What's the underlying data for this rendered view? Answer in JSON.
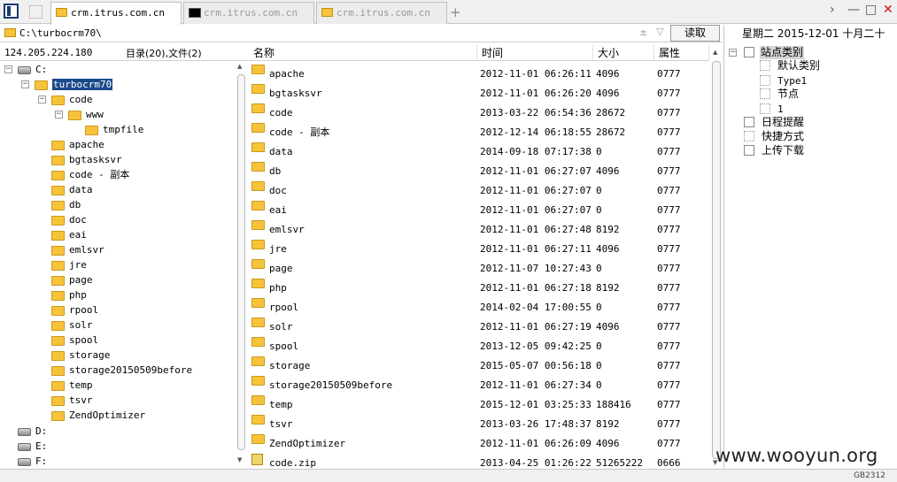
{
  "tabs": [
    {
      "label": "crm.itrus.com.cn",
      "icon": "folder-icon",
      "active": true
    },
    {
      "label": "crm.itrus.com.cn",
      "icon": "terminal-icon",
      "active": false
    },
    {
      "label": "crm.itrus.com.cn",
      "icon": "folder-icon",
      "active": false
    }
  ],
  "window": {
    "new_tab": "+",
    "nav": "›",
    "minimize": "—",
    "maximize": "□",
    "close": "✕",
    "close_color": "#d01010"
  },
  "address": {
    "path": "C:\\turbocrm70\\",
    "favorite_glyph": "±",
    "dropdown_glyph": "▽",
    "read_button": "读取"
  },
  "info": {
    "ip": "124.205.224.180",
    "counts": "目录(20),文件(2)"
  },
  "tree": {
    "drive_c": "C:",
    "root": "turbocrm70",
    "code": "code",
    "www": "www",
    "tmpfile": "tmpfile",
    "folders": [
      "apache",
      "bgtasksvr",
      "code - 副本",
      "data",
      "db",
      "doc",
      "eai",
      "emlsvr",
      "jre",
      "page",
      "php",
      "rpool",
      "solr",
      "spool",
      "storage",
      "storage20150509before",
      "temp",
      "tsvr",
      "ZendOptimizer"
    ],
    "drives": [
      "D:",
      "E:",
      "F:"
    ]
  },
  "list": {
    "headers": {
      "name": "名称",
      "time": "时间",
      "size": "大小",
      "attr": "属性"
    },
    "rows": [
      {
        "name": "apache",
        "time": "2012-11-01 06:26:11",
        "size": "4096",
        "attr": "0777",
        "type": "folder"
      },
      {
        "name": "bgtasksvr",
        "time": "2012-11-01 06:26:20",
        "size": "4096",
        "attr": "0777",
        "type": "folder"
      },
      {
        "name": "code",
        "time": "2013-03-22 06:54:36",
        "size": "28672",
        "attr": "0777",
        "type": "folder"
      },
      {
        "name": "code - 副本",
        "time": "2012-12-14 06:18:55",
        "size": "28672",
        "attr": "0777",
        "type": "folder"
      },
      {
        "name": "data",
        "time": "2014-09-18 07:17:38",
        "size": "0",
        "attr": "0777",
        "type": "folder"
      },
      {
        "name": "db",
        "time": "2012-11-01 06:27:07",
        "size": "4096",
        "attr": "0777",
        "type": "folder"
      },
      {
        "name": "doc",
        "time": "2012-11-01 06:27:07",
        "size": "0",
        "attr": "0777",
        "type": "folder"
      },
      {
        "name": "eai",
        "time": "2012-11-01 06:27:07",
        "size": "0",
        "attr": "0777",
        "type": "folder"
      },
      {
        "name": "emlsvr",
        "time": "2012-11-01 06:27:48",
        "size": "8192",
        "attr": "0777",
        "type": "folder"
      },
      {
        "name": "jre",
        "time": "2012-11-01 06:27:11",
        "size": "4096",
        "attr": "0777",
        "type": "folder"
      },
      {
        "name": "page",
        "time": "2012-11-07 10:27:43",
        "size": "0",
        "attr": "0777",
        "type": "folder"
      },
      {
        "name": "php",
        "time": "2012-11-01 06:27:18",
        "size": "8192",
        "attr": "0777",
        "type": "folder"
      },
      {
        "name": "rpool",
        "time": "2014-02-04 17:00:55",
        "size": "0",
        "attr": "0777",
        "type": "folder"
      },
      {
        "name": "solr",
        "time": "2012-11-01 06:27:19",
        "size": "4096",
        "attr": "0777",
        "type": "folder"
      },
      {
        "name": "spool",
        "time": "2013-12-05 09:42:25",
        "size": "0",
        "attr": "0777",
        "type": "folder"
      },
      {
        "name": "storage",
        "time": "2015-05-07 00:56:18",
        "size": "0",
        "attr": "0777",
        "type": "folder"
      },
      {
        "name": "storage20150509before",
        "time": "2012-11-01 06:27:34",
        "size": "0",
        "attr": "0777",
        "type": "folder"
      },
      {
        "name": "temp",
        "time": "2015-12-01 03:25:33",
        "size": "188416",
        "attr": "0777",
        "type": "folder"
      },
      {
        "name": "tsvr",
        "time": "2013-03-26 17:48:37",
        "size": "8192",
        "attr": "0777",
        "type": "folder"
      },
      {
        "name": "ZendOptimizer",
        "time": "2012-11-01 06:26:09",
        "size": "4096",
        "attr": "0777",
        "type": "folder"
      },
      {
        "name": "code.zip",
        "time": "2013-04-25 01:26:22",
        "size": "51265222",
        "attr": "0666",
        "type": "zip"
      }
    ]
  },
  "right_panel": {
    "date": "星期二  2015-12-01  十月二十",
    "site_category": "站点类别",
    "categories": [
      "默认类别",
      "Type1",
      "节点",
      "1"
    ],
    "schedule": "日程提醒",
    "shortcuts": "快捷方式",
    "upload_download": "上传下载"
  },
  "watermark": "www.wooyun.org",
  "status": {
    "encoding": "GB2312"
  }
}
